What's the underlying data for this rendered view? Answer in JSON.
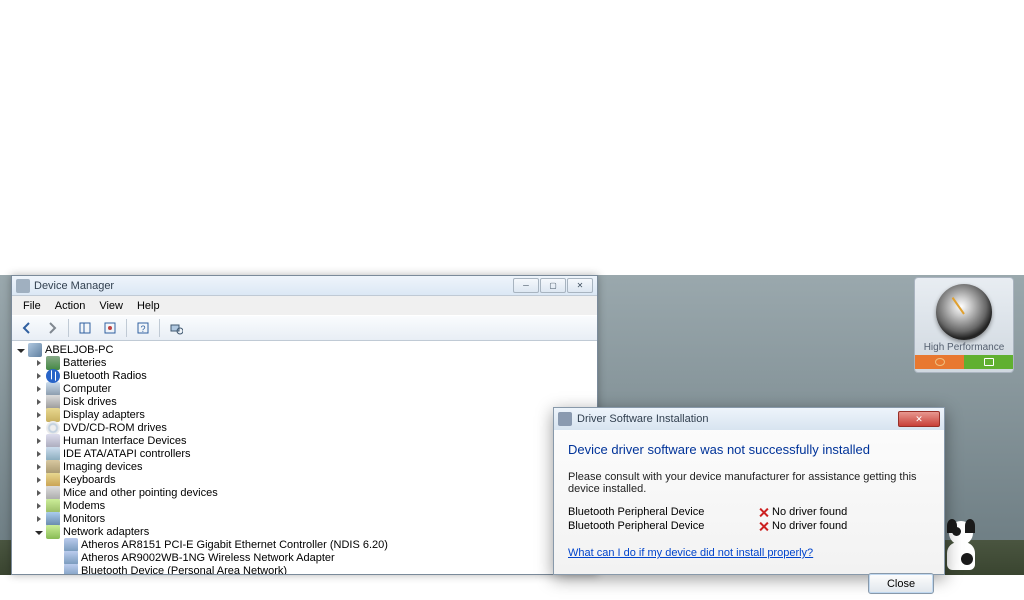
{
  "device_manager": {
    "title": "Device Manager",
    "menu": {
      "file": "File",
      "action": "Action",
      "view": "View",
      "help": "Help"
    },
    "root": "ABELJOB-PC",
    "categories": [
      {
        "label": "Batteries",
        "icon": "ic-bat"
      },
      {
        "label": "Bluetooth Radios",
        "icon": "ic-bt"
      },
      {
        "label": "Computer",
        "icon": "ic-comp"
      },
      {
        "label": "Disk drives",
        "icon": "ic-disk"
      },
      {
        "label": "Display adapters",
        "icon": "ic-disp"
      },
      {
        "label": "DVD/CD-ROM drives",
        "icon": "ic-dvd"
      },
      {
        "label": "Human Interface Devices",
        "icon": "ic-hid"
      },
      {
        "label": "IDE ATA/ATAPI controllers",
        "icon": "ic-ide"
      },
      {
        "label": "Imaging devices",
        "icon": "ic-img"
      },
      {
        "label": "Keyboards",
        "icon": "ic-kb"
      },
      {
        "label": "Mice and other pointing devices",
        "icon": "ic-mouse"
      },
      {
        "label": "Modems",
        "icon": "ic-modem"
      },
      {
        "label": "Monitors",
        "icon": "ic-mon"
      },
      {
        "label": "Network adapters",
        "icon": "ic-net",
        "open": true,
        "children": [
          {
            "label": "Atheros AR8151 PCI-E Gigabit Ethernet Controller (NDIS 6.20)",
            "icon": "ic-neta"
          },
          {
            "label": "Atheros AR9002WB-1NG Wireless Network Adapter",
            "icon": "ic-neta"
          },
          {
            "label": "Bluetooth Device (Personal Area Network)",
            "icon": "ic-neta"
          }
        ]
      }
    ]
  },
  "driver_dialog": {
    "title": "Driver Software Installation",
    "heading": "Device driver software was not successfully installed",
    "instruction": "Please consult with your device manufacturer for assistance getting this device installed.",
    "devices": [
      {
        "name": "Bluetooth Peripheral Device",
        "status": "No driver found"
      },
      {
        "name": "Bluetooth Peripheral Device",
        "status": "No driver found"
      }
    ],
    "help_link": "What can I do if my device did not install properly?",
    "close": "Close"
  },
  "perf_widget": {
    "label": "High Performance"
  }
}
